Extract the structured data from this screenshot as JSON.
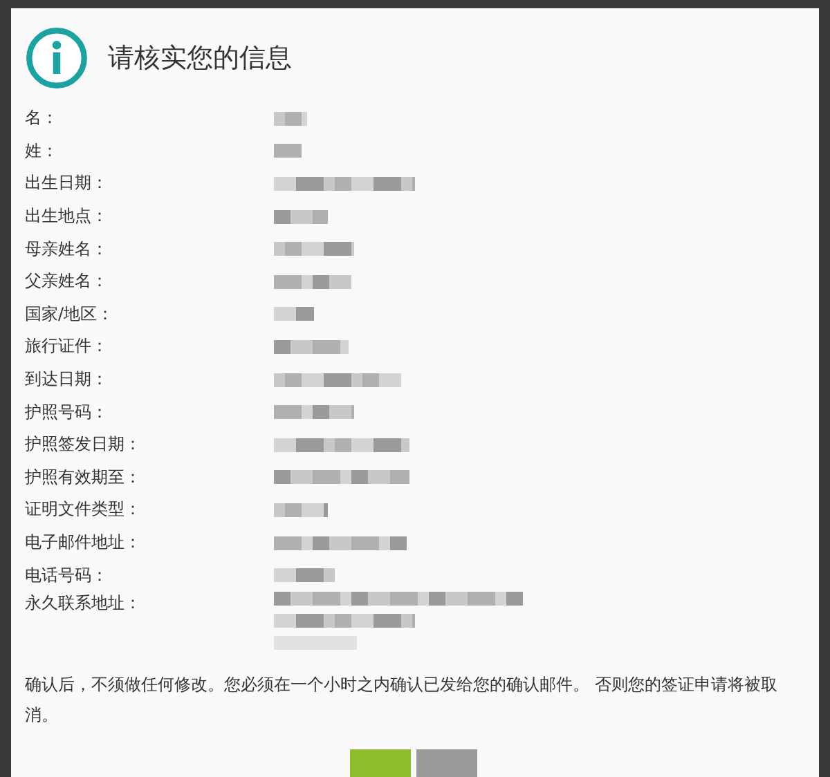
{
  "dialog": {
    "title": "请核实您的信息"
  },
  "fields": [
    {
      "label": "名："
    },
    {
      "label": "姓："
    },
    {
      "label": "出生日期："
    },
    {
      "label": "出生地点："
    },
    {
      "label": "母亲姓名："
    },
    {
      "label": "父亲姓名："
    },
    {
      "label": "国家/地区："
    },
    {
      "label": "旅行证件："
    },
    {
      "label": "到达日期："
    },
    {
      "label": "护照号码："
    },
    {
      "label": "护照签发日期："
    },
    {
      "label": "护照有效期至："
    },
    {
      "label": "证明文件类型："
    },
    {
      "label": "电子邮件地址："
    },
    {
      "label": "电话号码："
    },
    {
      "label": "永久联系地址：",
      "kind": "multiline"
    }
  ],
  "notice": "确认后，不须做任何修改。您必须在一个小时之内确认已发给您的确认邮件。 否则您的签证申请将被取消。"
}
